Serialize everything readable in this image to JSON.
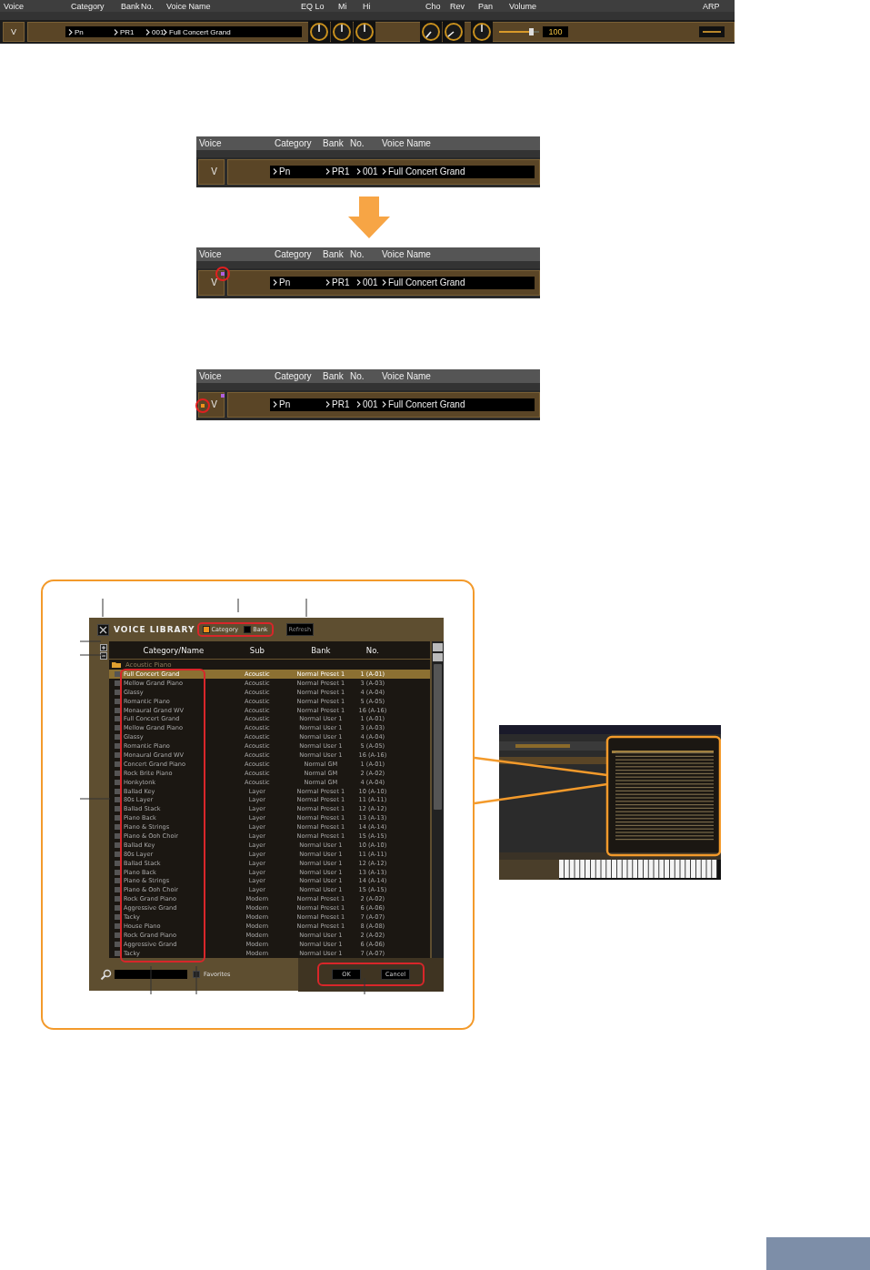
{
  "mixer_strip": {
    "headers": [
      "Voice",
      "Category",
      "Bank",
      "No.",
      "Voice Name",
      "EQ Lo",
      "Mi",
      "Hi",
      "Cho",
      "Rev",
      "Pan",
      "Volume",
      "ARP"
    ],
    "part": "V",
    "category": "Pn",
    "bank": "PR1",
    "number": "001",
    "voice_name": "Full Concert Grand",
    "volume": {
      "level": 0.8,
      "reading": "100"
    }
  },
  "voice_strips": [
    {
      "headers": [
        "Voice",
        "Category",
        "Bank",
        "No.",
        "Voice Name"
      ],
      "part": "V",
      "category": "Pn",
      "bank": "PR1",
      "number": "001",
      "voice_name": "Full Concert Grand",
      "edited": false,
      "indicator": false,
      "edited_circled": false,
      "indicator_circled": false
    },
    {
      "headers": [
        "Voice",
        "Category",
        "Bank",
        "No.",
        "Voice Name"
      ],
      "part": "V",
      "category": "Pn",
      "bank": "PR1",
      "number": "001",
      "voice_name": "Full Concert Grand",
      "edited": true,
      "indicator": false,
      "edited_circled": true,
      "indicator_circled": false
    },
    {
      "headers": [
        "Voice",
        "Category",
        "Bank",
        "No.",
        "Voice Name"
      ],
      "part": "V",
      "category": "Pn",
      "bank": "PR1",
      "number": "001",
      "voice_name": "Full Concert Grand",
      "edited": true,
      "indicator": true,
      "edited_circled": false,
      "indicator_circled": true
    }
  ],
  "library": {
    "title": "VOICE LIBRARY",
    "sort_options": [
      {
        "label": "Category",
        "selected": true
      },
      {
        "label": "Bank",
        "selected": false
      }
    ],
    "refresh": "Refresh",
    "columns": [
      "Category/Name",
      "Sub",
      "Bank",
      "No."
    ],
    "group": "Acoustic Piano",
    "rows": [
      {
        "name": "Full Concert Grand",
        "sub": "Acoustic",
        "bank": "Normal Preset 1",
        "no": "1 (A-01)",
        "selected": true
      },
      {
        "name": "Mellow Grand Piano",
        "sub": "Acoustic",
        "bank": "Normal Preset 1",
        "no": "3 (A-03)",
        "selected": false
      },
      {
        "name": "Glassy",
        "sub": "Acoustic",
        "bank": "Normal Preset 1",
        "no": "4 (A-04)",
        "selected": false
      },
      {
        "name": "Romantic Piano",
        "sub": "Acoustic",
        "bank": "Normal Preset 1",
        "no": "5 (A-05)",
        "selected": false
      },
      {
        "name": "Monaural Grand WV",
        "sub": "Acoustic",
        "bank": "Normal Preset 1",
        "no": "16 (A-16)",
        "selected": false
      },
      {
        "name": "Full Concert Grand",
        "sub": "Acoustic",
        "bank": "Normal User 1",
        "no": "1 (A-01)",
        "selected": false
      },
      {
        "name": "Mellow Grand Piano",
        "sub": "Acoustic",
        "bank": "Normal User 1",
        "no": "3 (A-03)",
        "selected": false
      },
      {
        "name": "Glassy",
        "sub": "Acoustic",
        "bank": "Normal User 1",
        "no": "4 (A-04)",
        "selected": false
      },
      {
        "name": "Romantic Piano",
        "sub": "Acoustic",
        "bank": "Normal User 1",
        "no": "5 (A-05)",
        "selected": false
      },
      {
        "name": "Monaural Grand WV",
        "sub": "Acoustic",
        "bank": "Normal User 1",
        "no": "16 (A-16)",
        "selected": false
      },
      {
        "name": "Concert Grand Piano",
        "sub": "Acoustic",
        "bank": "Normal GM",
        "no": "1 (A-01)",
        "selected": false
      },
      {
        "name": "Rock Brite Piano",
        "sub": "Acoustic",
        "bank": "Normal GM",
        "no": "2 (A-02)",
        "selected": false
      },
      {
        "name": "Honkytonk",
        "sub": "Acoustic",
        "bank": "Normal GM",
        "no": "4 (A-04)",
        "selected": false
      },
      {
        "name": "Ballad Key",
        "sub": "Layer",
        "bank": "Normal Preset 1",
        "no": "10 (A-10)",
        "selected": false
      },
      {
        "name": "80s Layer",
        "sub": "Layer",
        "bank": "Normal Preset 1",
        "no": "11 (A-11)",
        "selected": false
      },
      {
        "name": "Ballad Stack",
        "sub": "Layer",
        "bank": "Normal Preset 1",
        "no": "12 (A-12)",
        "selected": false
      },
      {
        "name": "Piano Back",
        "sub": "Layer",
        "bank": "Normal Preset 1",
        "no": "13 (A-13)",
        "selected": false
      },
      {
        "name": "Piano & Strings",
        "sub": "Layer",
        "bank": "Normal Preset 1",
        "no": "14 (A-14)",
        "selected": false
      },
      {
        "name": "Piano & Ooh Choir",
        "sub": "Layer",
        "bank": "Normal Preset 1",
        "no": "15 (A-15)",
        "selected": false
      },
      {
        "name": "Ballad Key",
        "sub": "Layer",
        "bank": "Normal User 1",
        "no": "10 (A-10)",
        "selected": false
      },
      {
        "name": "80s Layer",
        "sub": "Layer",
        "bank": "Normal User 1",
        "no": "11 (A-11)",
        "selected": false
      },
      {
        "name": "Ballad Stack",
        "sub": "Layer",
        "bank": "Normal User 1",
        "no": "12 (A-12)",
        "selected": false
      },
      {
        "name": "Piano Back",
        "sub": "Layer",
        "bank": "Normal User 1",
        "no": "13 (A-13)",
        "selected": false
      },
      {
        "name": "Piano & Strings",
        "sub": "Layer",
        "bank": "Normal User 1",
        "no": "14 (A-14)",
        "selected": false
      },
      {
        "name": "Piano & Ooh Choir",
        "sub": "Layer",
        "bank": "Normal User 1",
        "no": "15 (A-15)",
        "selected": false
      },
      {
        "name": "Rock Grand Piano",
        "sub": "Modern",
        "bank": "Normal Preset 1",
        "no": "2 (A-02)",
        "selected": false
      },
      {
        "name": "Aggressive Grand",
        "sub": "Modern",
        "bank": "Normal Preset 1",
        "no": "6 (A-06)",
        "selected": false
      },
      {
        "name": "Tacky",
        "sub": "Modern",
        "bank": "Normal Preset 1",
        "no": "7 (A-07)",
        "selected": false
      },
      {
        "name": "House Piano",
        "sub": "Modern",
        "bank": "Normal Preset 1",
        "no": "8 (A-08)",
        "selected": false
      },
      {
        "name": "Rock Grand Piano",
        "sub": "Modern",
        "bank": "Normal User 1",
        "no": "2 (A-02)",
        "selected": false
      },
      {
        "name": "Aggressive Grand",
        "sub": "Modern",
        "bank": "Normal User 1",
        "no": "6 (A-06)",
        "selected": false
      },
      {
        "name": "Tacky",
        "sub": "Modern",
        "bank": "Normal User 1",
        "no": "7 (A-07)",
        "selected": false
      }
    ],
    "favorites": {
      "label": "Favorites",
      "checked": false
    },
    "buttons": [
      "OK",
      "Cancel"
    ]
  }
}
